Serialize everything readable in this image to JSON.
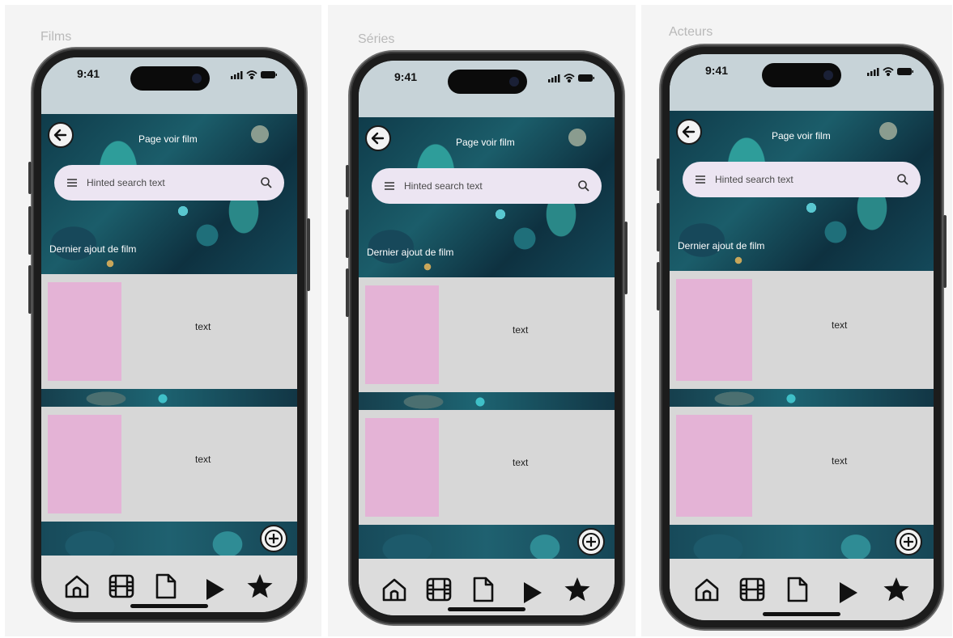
{
  "frames": [
    {
      "label": "Films",
      "time": "9:41",
      "page_title": "Page voir film",
      "search_placeholder": "Hinted search text",
      "section_title": "Dernier ajout de film",
      "cards": [
        {
          "text": "text"
        },
        {
          "text": "text"
        }
      ]
    },
    {
      "label": "Séries",
      "time": "9:41",
      "page_title": "Page voir film",
      "search_placeholder": "Hinted search text",
      "section_title": "Dernier ajout de film",
      "cards": [
        {
          "text": "text"
        },
        {
          "text": "text"
        }
      ]
    },
    {
      "label": "Acteurs",
      "time": "9:41",
      "page_title": "Page voir film",
      "search_placeholder": "Hinted search text",
      "section_title": "Dernier ajout de film",
      "cards": [
        {
          "text": "text"
        },
        {
          "text": "text"
        }
      ]
    }
  ],
  "nav_icons": [
    "home-icon",
    "film-icon",
    "document-icon",
    "play-icon",
    "star-icon"
  ],
  "icons": {
    "back": "arrow-left-icon",
    "menu": "menu-icon",
    "search": "search-icon",
    "add": "plus-circle-icon",
    "signal": "signal-icon",
    "wifi": "wifi-icon",
    "battery": "battery-icon"
  },
  "colors": {
    "thumbnail": "#e4b3d6",
    "card": "#d7d7d7",
    "search_bar": "#ece5f2",
    "navbar": "#dcdcdc"
  }
}
